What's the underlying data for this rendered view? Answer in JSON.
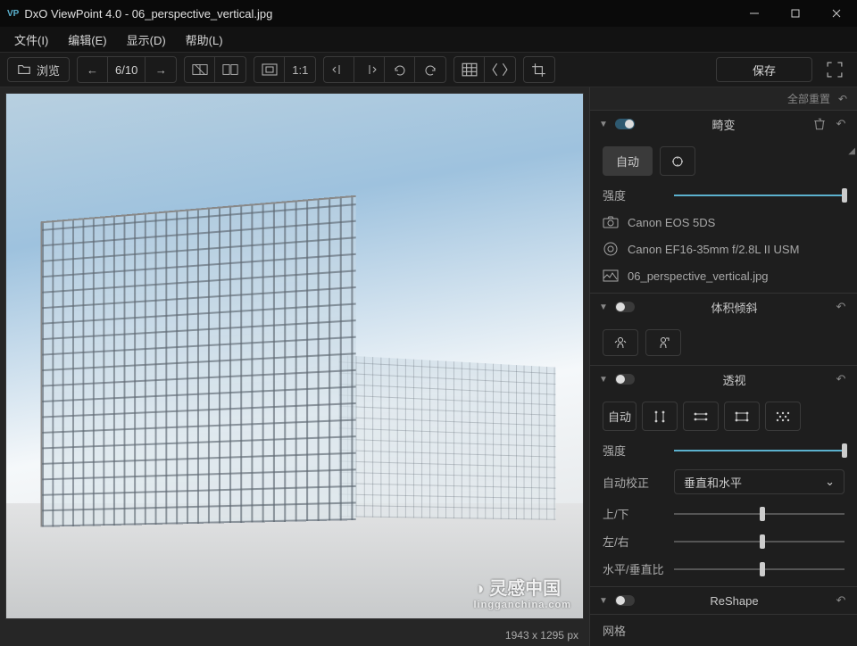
{
  "window": {
    "logo": "VP",
    "title": "DxO ViewPoint 4.0 - 06_perspective_vertical.jpg"
  },
  "menu": {
    "file": "文件(I)",
    "edit": "编辑(E)",
    "view": "显示(D)",
    "help": "帮助(L)"
  },
  "toolbar": {
    "browse": "浏览",
    "nav_position": "6/10",
    "zoom_11": "1:1",
    "save": "保存"
  },
  "panel_header": {
    "reset_all": "全部重置"
  },
  "sections": {
    "distortion": {
      "title": "畸变",
      "auto": "自动",
      "intensity": "强度",
      "camera": "Canon EOS 5DS",
      "lens": "Canon EF16-35mm f/2.8L II USM",
      "file": "06_perspective_vertical.jpg",
      "intensity_percent": 100
    },
    "volume": {
      "title": "体积倾斜"
    },
    "perspective": {
      "title": "透视",
      "auto": "自动",
      "intensity": "强度",
      "intensity_percent": 100,
      "auto_correct_label": "自动校正",
      "auto_correct_value": "垂直和水平",
      "updown": "上/下",
      "updown_percent": 52,
      "leftright": "左/右",
      "leftright_percent": 52,
      "ratio": "水平/垂直比"
    },
    "reshape": {
      "title": "ReShape"
    },
    "crop": {
      "title": "网格"
    }
  },
  "statusbar": {
    "dimensions": "1943 x 1295 px"
  },
  "watermark": {
    "main": "灵感中国",
    "sub": "lingganchina.com"
  }
}
